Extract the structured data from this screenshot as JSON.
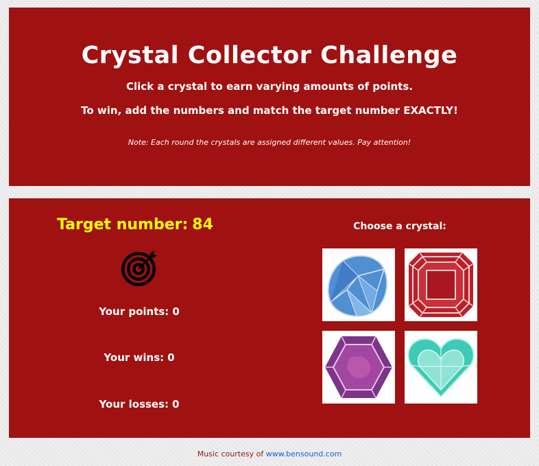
{
  "header": {
    "title": "Crystal Collector Challenge",
    "instruction": "Click a crystal to earn varying amounts of points.",
    "goal": "To win, add the numbers and match the target number EXACTLY!",
    "note": "Note: Each round the crystals are assigned different values. Pay attention!"
  },
  "game": {
    "target_label": "Target number:",
    "target_value": "84",
    "target_icon": "target-icon",
    "points_label": "Your points:",
    "points_value": "0",
    "wins_label": "Your wins:",
    "wins_value": "0",
    "losses_label": "Your losses:",
    "losses_value": "0",
    "choose_label": "Choose a crystal:",
    "crystals": [
      {
        "name": "blue-pear-crystal",
        "color": "#5b95d4"
      },
      {
        "name": "red-emerald-cut-crystal",
        "color": "#c0262c"
      },
      {
        "name": "purple-hexagon-crystal",
        "color": "#8a3a8e"
      },
      {
        "name": "teal-heart-crystal",
        "color": "#3ccbb5"
      }
    ]
  },
  "footer": {
    "text": "Music courtesy of",
    "link": "www.bensound.com"
  },
  "colors": {
    "panel": "#a01111",
    "target_text": "#ffff00",
    "link": "#1a5fd6"
  }
}
